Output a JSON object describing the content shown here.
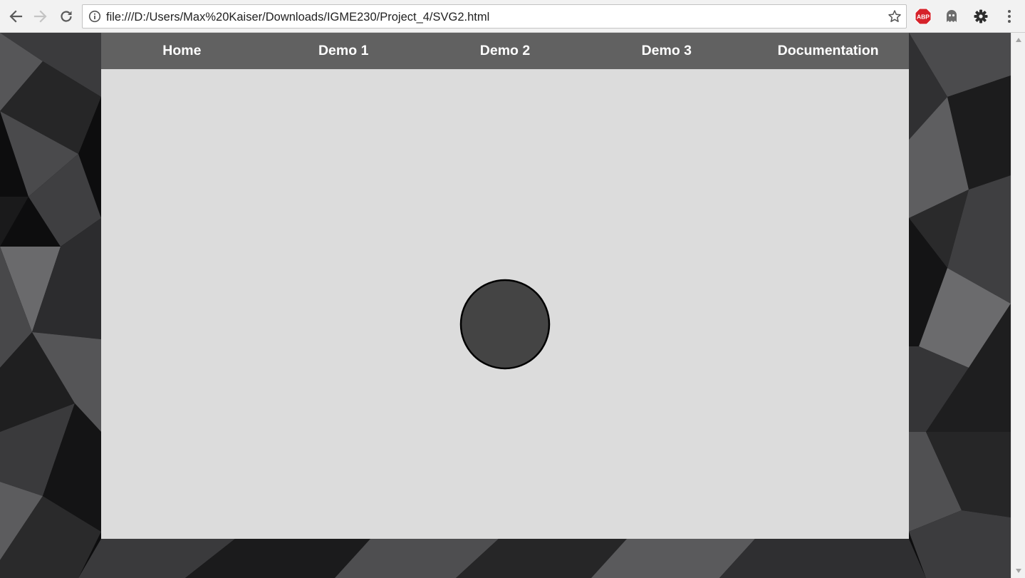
{
  "browser": {
    "url": "file:///D:/Users/Max%20Kaiser/Downloads/IGME230/Project_4/SVG2.html",
    "icons": {
      "back": "arrow-left",
      "forward": "arrow-right",
      "reload": "reload",
      "info": "info-circle",
      "bookmark": "star",
      "adblock": "abp",
      "ghostery": "ghost",
      "extension": "gear",
      "menu": "vertical-dots"
    },
    "adblock_badge": "ABP"
  },
  "nav": {
    "items": [
      {
        "label": "Home"
      },
      {
        "label": "Demo 1"
      },
      {
        "label": "Demo 2"
      },
      {
        "label": "Demo 3"
      },
      {
        "label": "Documentation"
      }
    ]
  },
  "stage": {
    "shape": "circle",
    "fill": "#444444",
    "stroke": "#000000",
    "background": "#dcdcdc"
  },
  "colors": {
    "nav_bar": "#616161",
    "nav_text": "#ffffff",
    "container": "#dcdcdc",
    "adblock_red": "#d6222a"
  }
}
